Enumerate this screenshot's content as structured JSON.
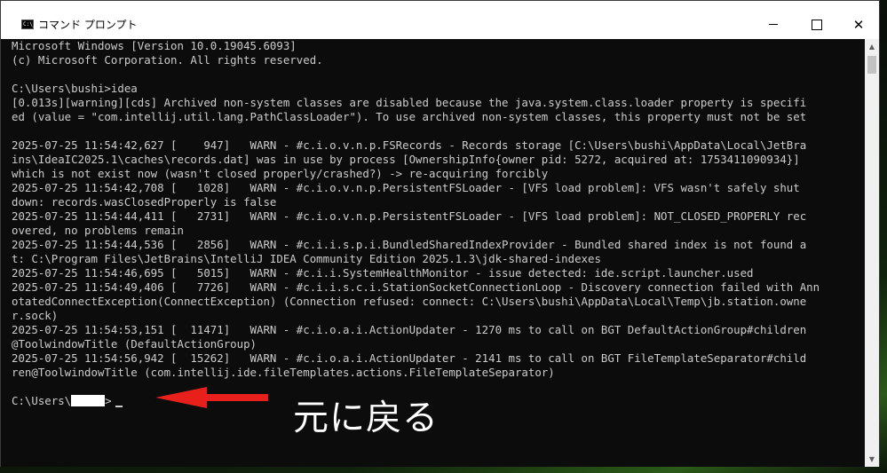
{
  "window": {
    "title": "コマンド プロンプト",
    "minimize_glyph": "",
    "close_glyph": "✕"
  },
  "console": {
    "lines": [
      "Microsoft Windows [Version 10.0.19045.6093]",
      "(c) Microsoft Corporation. All rights reserved.",
      "",
      "C:\\Users\\bushi>idea",
      "[0.013s][warning][cds] Archived non-system classes are disabled because the java.system.class.loader property is specifi",
      "ed (value = \"com.intellij.util.lang.PathClassLoader\"). To use archived non-system classes, this property must not be set",
      "",
      "2025-07-25 11:54:42,627 [    947]   WARN - #c.i.o.v.n.p.FSRecords - Records storage [C:\\Users\\bushi\\AppData\\Local\\JetBra",
      "ins\\IdeaIC2025.1\\caches\\records.dat] was in use by process [OwnershipInfo{owner pid: 5272, acquired at: 1753411090934}]",
      "which is not exist now (wasn't closed properly/crashed?) -> re-acquiring forcibly",
      "2025-07-25 11:54:42,708 [   1028]   WARN - #c.i.o.v.n.p.PersistentFSLoader - [VFS load problem]: VFS wasn't safely shut",
      "down: records.wasClosedProperly is false",
      "2025-07-25 11:54:44,411 [   2731]   WARN - #c.i.o.v.n.p.PersistentFSLoader - [VFS load problem]: NOT_CLOSED_PROPERLY rec",
      "overed, no problems remain",
      "2025-07-25 11:54:44,536 [   2856]   WARN - #c.i.i.s.p.i.BundledSharedIndexProvider - Bundled shared index is not found a",
      "t: C:\\Program Files\\JetBrains\\IntelliJ IDEA Community Edition 2025.1.3\\jdk-shared-indexes",
      "2025-07-25 11:54:46,695 [   5015]   WARN - #c.i.i.SystemHealthMonitor - issue detected: ide.script.launcher.used",
      "2025-07-25 11:54:49,406 [   7726]   WARN - #c.i.i.s.c.i.StationSocketConnectionLoop - Discovery connection failed with Ann",
      "otatedConnectException(ConnectException) (Connection refused: connect: C:\\Users\\bushi\\AppData\\Local\\Temp\\jb.station.owne",
      "r.sock)",
      "2025-07-25 11:54:53,151 [  11471]   WARN - #c.i.o.a.i.ActionUpdater - 1270 ms to call on BGT DefaultActionGroup#children",
      "@ToolwindowTitle (DefaultActionGroup)",
      "2025-07-25 11:54:56,942 [  15262]   WARN - #c.i.o.a.i.ActionUpdater - 2141 ms to call on BGT FileTemplateSeparator#child",
      "ren@ToolwindowTitle (com.intellij.ide.fileTemplates.actions.FileTemplateSeparator)",
      ""
    ],
    "prompt_prefix": "C:\\Users\\",
    "prompt_suffix": ">"
  },
  "annotation": {
    "text": "元に戻る",
    "arrow_color": "#e8201c",
    "text_color": "#ffffff"
  },
  "scrollbar": {
    "up_glyph": "▲",
    "down_glyph": "▼"
  }
}
